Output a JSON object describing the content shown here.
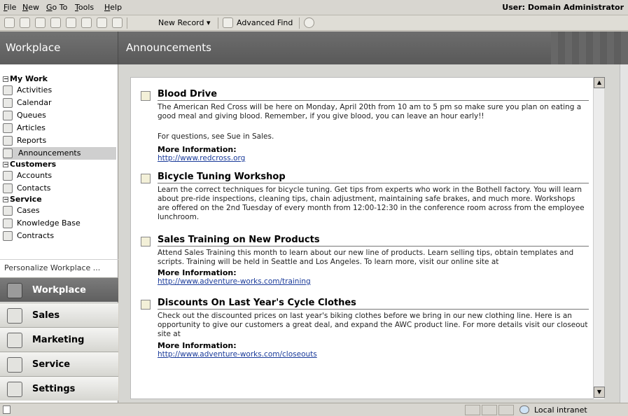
{
  "menu": {
    "items": [
      {
        "label": "File",
        "u": "F",
        "rest": "ile"
      },
      {
        "label": "New",
        "u": "N",
        "rest": "ew"
      },
      {
        "label": "Go To",
        "u": "G",
        "rest": "o To"
      },
      {
        "label": "Tools",
        "u": "T",
        "rest": "ools"
      },
      {
        "label": "Help",
        "u": "H",
        "rest": "elp"
      }
    ],
    "user": "User: Domain Administrator"
  },
  "toolbar": {
    "new_record": "New Record ▾",
    "advanced_find": "Advanced Find"
  },
  "header": {
    "left_title": "Workplace",
    "right_title": "Announcements"
  },
  "sidebar": {
    "groups": [
      {
        "label": "My Work",
        "items": [
          "Activities",
          "Calendar",
          "Queues",
          "Articles",
          "Reports",
          "Announcements"
        ]
      },
      {
        "label": "Customers",
        "items": [
          "Accounts",
          "Contacts"
        ]
      },
      {
        "label": "Service",
        "items": [
          "Cases",
          "Knowledge Base",
          "Contracts"
        ]
      }
    ],
    "selected_item": "Announcements",
    "personalize": "Personalize Workplace ...",
    "nav_buttons": [
      "Workplace",
      "Sales",
      "Marketing",
      "Service",
      "Settings"
    ],
    "active_nav": "Workplace"
  },
  "announcements": [
    {
      "title": "Blood Drive",
      "body": "The American Red Cross will be here on Monday, April 20th from 10 am to 5 pm so make sure you plan on eating a good meal and giving blood. Remember, if you give blood, you can leave an hour early!!",
      "body2": "For questions, see Sue in Sales.",
      "more_info_label": "More Information:",
      "link": "http://www.redcross.org"
    },
    {
      "title": "Bicycle Tuning Workshop",
      "body": "Learn the correct techniques for bicycle tuning. Get tips from experts who work in the Bothell factory. You will learn about pre-ride inspections, cleaning tips, chain adjustment, maintaining safe brakes, and much more. Workshops are offered on the 2nd Tuesday of every month from 12:00-12:30 in the conference room across from the employee lunchroom."
    },
    {
      "title": "Sales Training on New Products",
      "body": "Attend Sales Training this month to learn about our new line of products. Learn selling tips, obtain templates and scripts. Training will be held in Seattle and Los Angeles. To learn more, visit our online site at",
      "more_info_label": "More Information:",
      "link": "http://www.adventure-works.com/training"
    },
    {
      "title": "Discounts On Last Year's Cycle Clothes",
      "body": "Check out the discounted prices on last year's biking clothes before we bring in our new clothing line. Here is an opportunity to give our customers a great deal, and expand the AWC product line. For more details visit our closeout site at",
      "more_info_label": "More Information:",
      "link": "http://www.adventure-works.com/closeouts"
    }
  ],
  "status": {
    "zone": "Local intranet"
  }
}
